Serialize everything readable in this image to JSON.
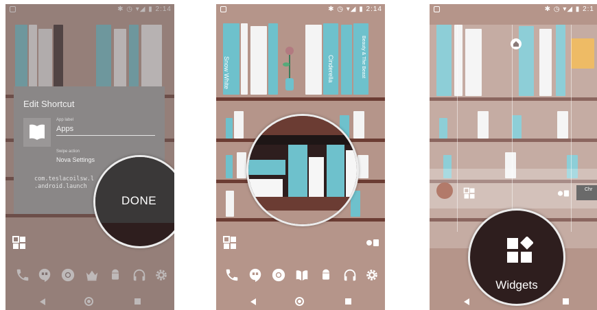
{
  "status_bar": {
    "time": "2:14",
    "time_partial": "2:1"
  },
  "panel1": {
    "dialog": {
      "title": "Edit Shortcut",
      "app_label_caption": "App label",
      "app_label_value": "Apps",
      "swipe_action_caption": "Swipe action",
      "swipe_action_value": "Nova Settings",
      "package_line1": "com.teslacoilsw.l",
      "package_line2": ".android.launch"
    },
    "done_button": "DONE"
  },
  "panel2": {
    "book_titles": [
      "Snow White",
      "Cinderella",
      "Beauty & The Beast"
    ]
  },
  "panel3": {
    "widgets_button": "Widgets",
    "side_label": "Chr"
  },
  "icons": [
    "phone-icon",
    "hangouts-icon",
    "chrome-icon",
    "crown-icon",
    "android-icon",
    "headphones-icon",
    "settings-icon",
    "apps-drawer-icon",
    "book-icon",
    "home-icon"
  ],
  "colors": {
    "wall": "#b5958a",
    "book_blue": "#6ec1cc",
    "shelf": "#6b3c33",
    "dialog": "#8a8787",
    "bubble": "#2e1e1e"
  }
}
